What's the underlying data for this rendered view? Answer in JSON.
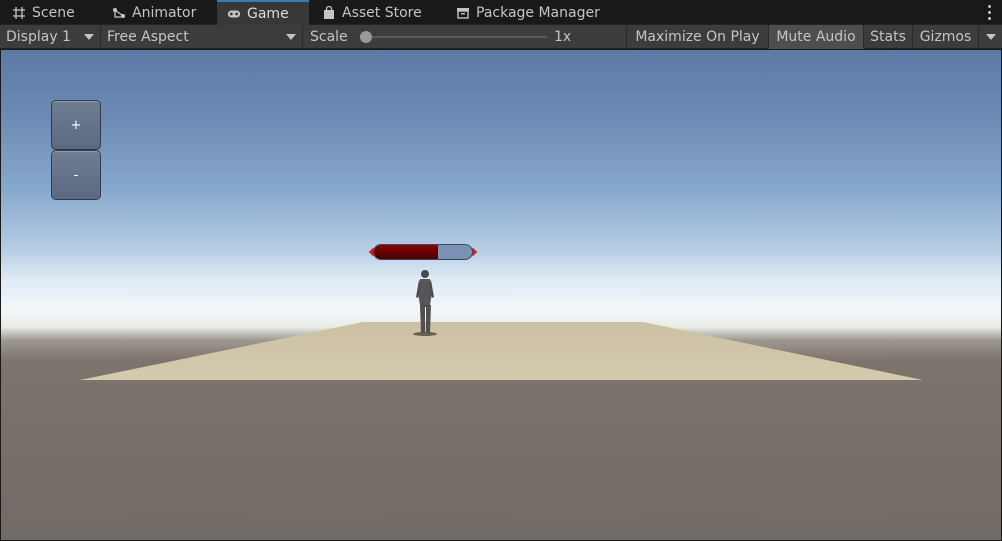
{
  "tabs": [
    {
      "label": "Scene",
      "icon": "grid-icon",
      "active": false
    },
    {
      "label": "Animator",
      "icon": "animator-icon",
      "active": false
    },
    {
      "label": "Game",
      "icon": "gamepad-icon",
      "active": true
    },
    {
      "label": "Asset Store",
      "icon": "shopping-bag-icon",
      "active": false
    },
    {
      "label": "Package Manager",
      "icon": "package-icon",
      "active": false
    }
  ],
  "toolbar": {
    "display": "Display 1",
    "aspect": "Free Aspect",
    "scale_label": "Scale",
    "scale_value": "1x",
    "scale_fraction": 0,
    "maximize_on_play": "Maximize On Play",
    "mute_audio": "Mute Audio",
    "stats": "Stats",
    "gizmos": "Gizmos"
  },
  "game_view": {
    "zoom_in_label": "+",
    "zoom_out_label": "-",
    "health_fraction": 0.65,
    "colors": {
      "tab_accent": "#3a79bb",
      "health_fill": "#6a0000",
      "health_bg": "#7a92b3",
      "floor": "#cbc0a3"
    }
  }
}
